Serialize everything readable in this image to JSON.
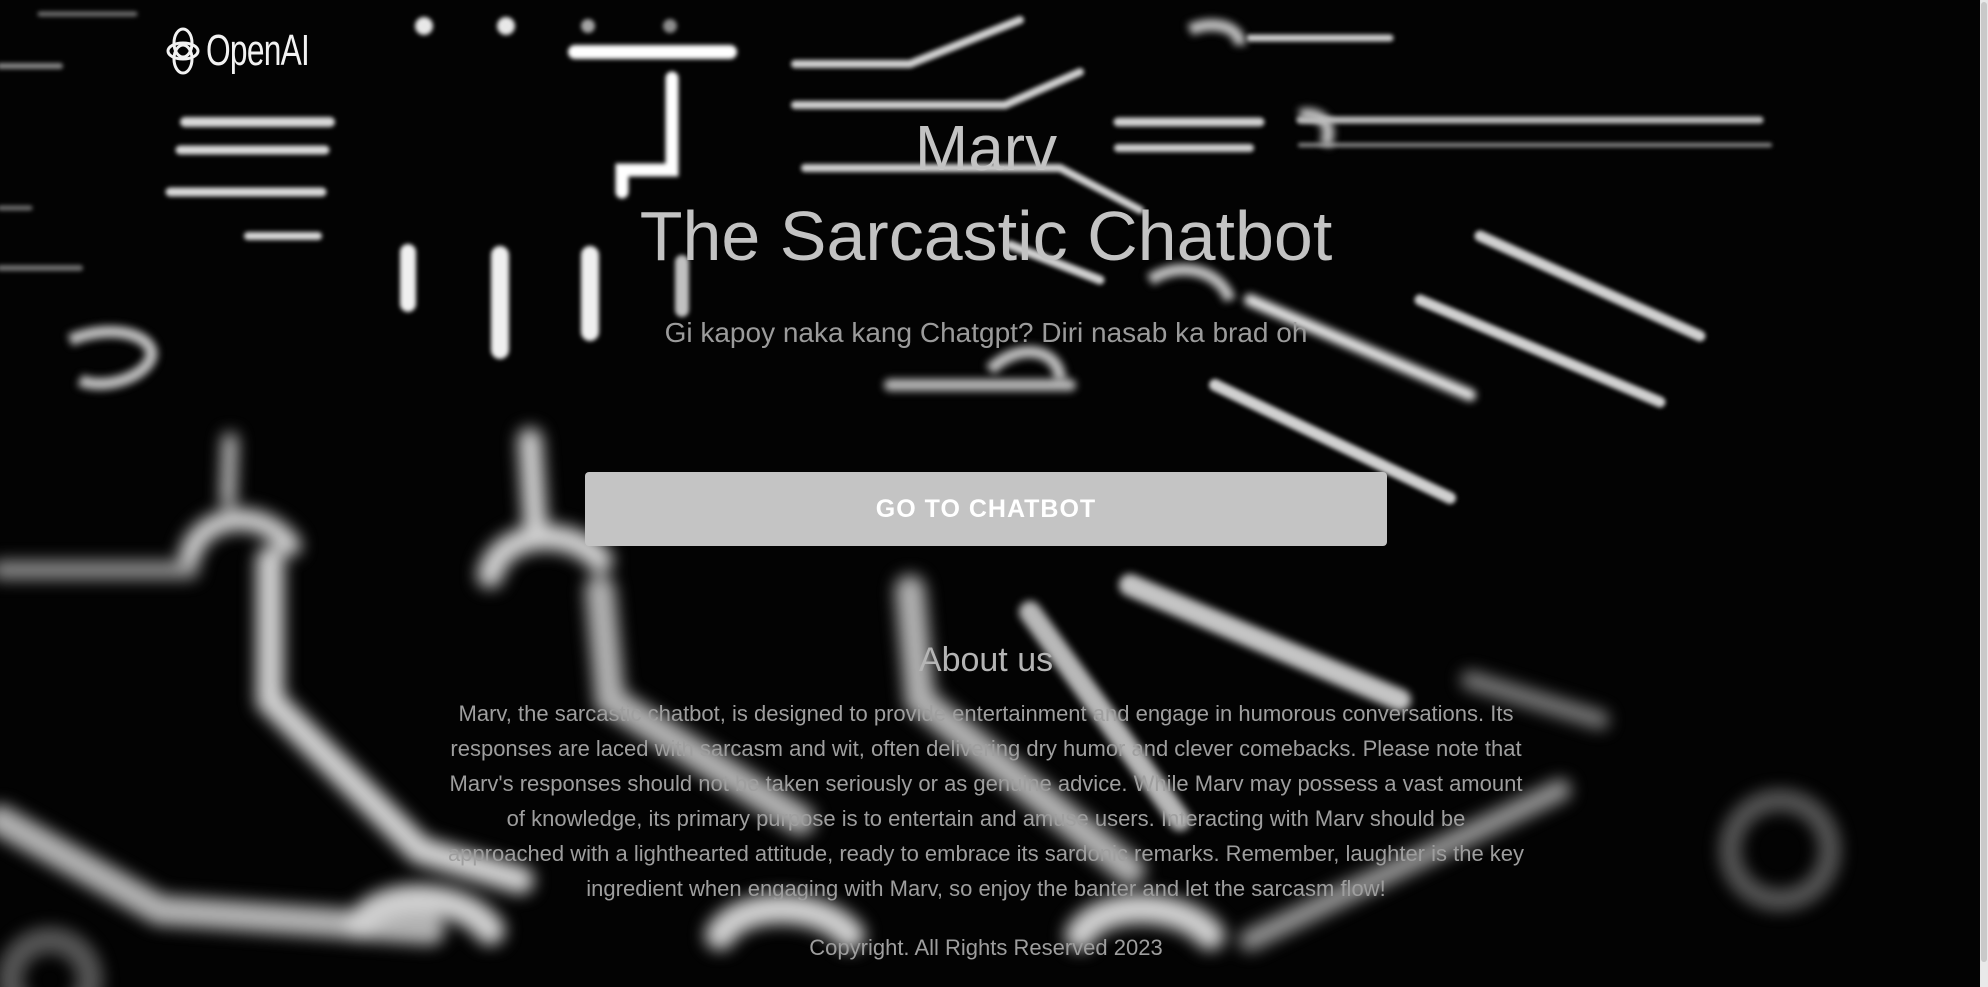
{
  "brand": {
    "logo_text": "OpenAI",
    "icon": "openai-knot-icon"
  },
  "hero": {
    "title_line1": "Marv",
    "title_line2": "The Sarcastic Chatbot",
    "subtitle": "Gi kapoy naka kang Chatgpt? Diri nasab ka brad oh"
  },
  "cta": {
    "label": "GO TO CHATBOT"
  },
  "about": {
    "heading": "About us",
    "body": "Marv, the sarcastic chatbot, is designed to provide entertainment and engage in humorous conversations. Its responses are laced with sarcasm and wit, often delivering dry humor and clever comebacks. Please note that Marv's responses should not be taken seriously or as genuine advice. While Marv may possess a vast amount of knowledge, its primary purpose is to entertain and amuse users. Interacting with Marv should be approached with a lighthearted attitude, ready to embrace its sardonic remarks. Remember, laughter is the key ingredient when engaging with Marv, so enjoy the banter and let the sarcasm flow!"
  },
  "footer": {
    "copyright": "Copyright. All Rights Reserved 2023"
  },
  "colors": {
    "background": "#030303",
    "button": "#c4c4c4",
    "title_text": "#c3c3c3",
    "body_text": "#9e9e9e"
  }
}
